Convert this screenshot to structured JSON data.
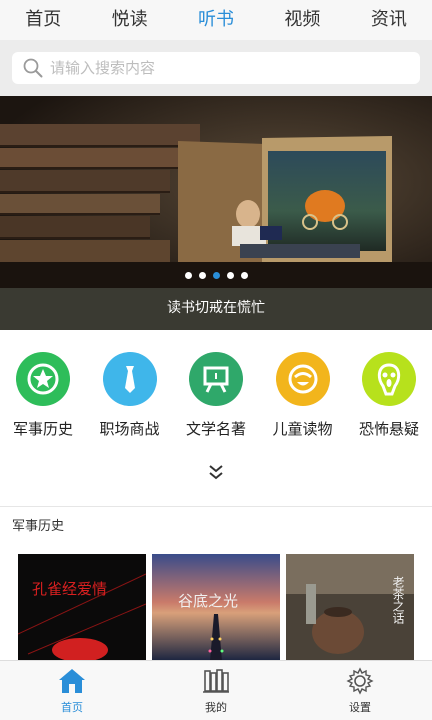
{
  "top_tabs": [
    {
      "label": "首页"
    },
    {
      "label": "悦读"
    },
    {
      "label": "听书"
    },
    {
      "label": "视频"
    },
    {
      "label": "资讯"
    }
  ],
  "active_tab": "听书",
  "search": {
    "placeholder": "请输入搜索内容"
  },
  "banner": {
    "caption": "读书切戒在慌忙",
    "slide_count": 5,
    "active_slide": 3
  },
  "categories": [
    {
      "label": "军事历史",
      "color": "#2ebd5a",
      "icon": "military-icon"
    },
    {
      "label": "职场商战",
      "color": "#3fb6ea",
      "icon": "tie-icon"
    },
    {
      "label": "文学名著",
      "color": "#2fa86a",
      "icon": "easel-icon"
    },
    {
      "label": "儿童读物",
      "color": "#f2b51c",
      "icon": "child-face-icon"
    },
    {
      "label": "恐怖悬疑",
      "color": "#b7e11c",
      "icon": "scream-icon"
    }
  ],
  "section": {
    "title": "军事历史",
    "books": [
      {
        "cover_text": "孔雀经爱情",
        "cover": "red-dark"
      },
      {
        "cover_text": "谷底之光",
        "cover": "sunset-pier"
      },
      {
        "cover_text": "老茶之话",
        "cover": "teapot"
      }
    ]
  },
  "bottom_nav": [
    {
      "label": "首页",
      "icon": "home-icon",
      "active": true
    },
    {
      "label": "我的",
      "icon": "bookshelf-icon",
      "active": false
    },
    {
      "label": "设置",
      "icon": "gear-icon",
      "active": false
    }
  ],
  "colors": {
    "accent": "#2a8ed8"
  }
}
